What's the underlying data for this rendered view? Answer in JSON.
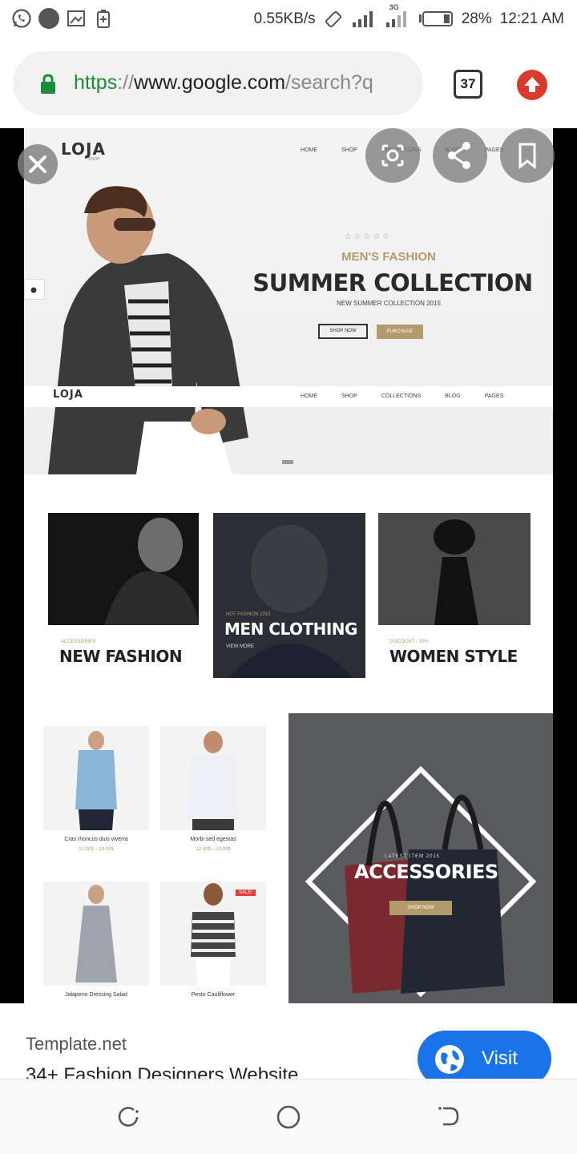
{
  "status_bar": {
    "net_speed": "0.55KB/s",
    "network_type": "3G",
    "battery": "28%",
    "time": "12:21 AM",
    "icons": [
      "whatsapp-icon",
      "avatar-icon",
      "screenshot-icon",
      "battery-saver-icon",
      "rotate-lock-icon",
      "signal-icon",
      "battery-icon"
    ]
  },
  "browser": {
    "url_scheme": "https",
    "url_sep": "://",
    "url_host": "www.google.com",
    "url_path": "/search?q",
    "tabs_count": "37"
  },
  "template": {
    "logo": "LOJA",
    "logo_sub": "SHOP",
    "nav": [
      "HOME",
      "SHOP",
      "COLLECTIONS",
      "BLOG",
      "PAGES"
    ],
    "hero_eyebrow": "MEN'S FASHION",
    "hero_title": "SUMMER COLLECTION",
    "hero_subtitle": "NEW SUMMER COLLECTION 2015",
    "hero_btn_1": "SHOP NOW",
    "hero_btn_2": "PURCHASE",
    "categories": [
      {
        "eyebrow": "ACCESSORIES",
        "title": "NEW FASHION"
      },
      {
        "eyebrow": "HOT FASHION 2015",
        "title": "MEN CLOTHING",
        "link": "VIEW MORE"
      },
      {
        "eyebrow": "DISCOUNT - 30%",
        "title": "WOMEN STYLE"
      }
    ],
    "products": [
      {
        "name": "Cras rhoncus duis viverra",
        "price": "12.00$ – 23.00$"
      },
      {
        "name": "Morbi sed egestas",
        "price": "12.00$ – 23.00$"
      },
      {
        "name": "Jalapeno Dressing Salad",
        "price": ""
      },
      {
        "name": "Pesto Cauliflower",
        "price": "",
        "badge": "SALE!"
      }
    ],
    "promo_eyebrow": "LATEST ITEM 2015",
    "promo_title": "ACCESSORIES",
    "promo_btn": "SHOP NOW"
  },
  "result": {
    "site": "Template.net",
    "title": "34+ Fashion Designers Website",
    "visit_label": "Visit"
  },
  "colors": {
    "accent_gold": "#b39a6c",
    "visit_blue": "#1a73e8",
    "lock_green": "#1a8c3a",
    "update_red": "#d93a2b"
  }
}
